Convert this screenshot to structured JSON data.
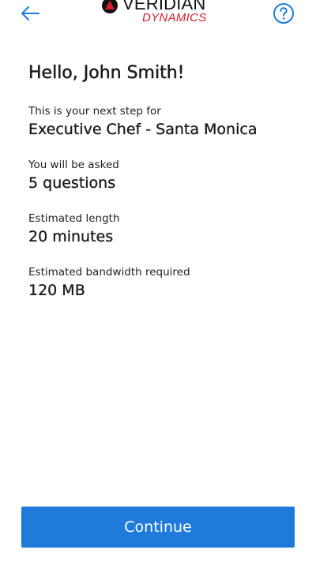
{
  "header": {
    "back_icon": "arrow-left-icon",
    "help_icon": "question-circle-icon",
    "logo": {
      "line1": "VERIDIAN",
      "line2": "DYNAMICS",
      "mark_icon": "triangle-in-circle-icon"
    }
  },
  "main": {
    "greeting": "Hello, John Smith!",
    "info": [
      {
        "label": "This is your next step for",
        "value": "Executive Chef - Santa Monica"
      },
      {
        "label": "You will be asked",
        "value": "5 questions"
      },
      {
        "label": "Estimated length",
        "value": "20 minutes"
      },
      {
        "label": "Estimated bandwidth required",
        "value": "120 MB"
      }
    ]
  },
  "footer": {
    "continue_label": "Continue"
  },
  "colors": {
    "accent": "#1f7ad9",
    "brand_red": "#d21f2b",
    "text": "#1c1c1c",
    "background": "#ffffff"
  }
}
